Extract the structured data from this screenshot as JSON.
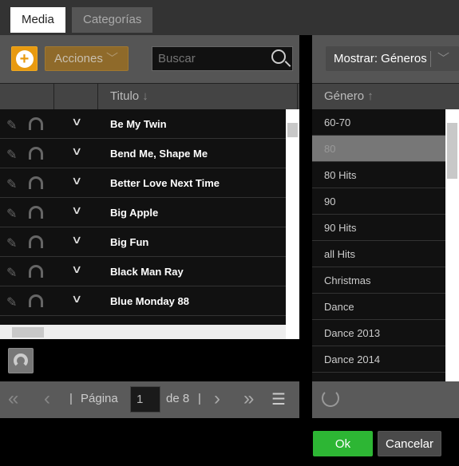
{
  "tabs": [
    {
      "label": "Media",
      "active": true
    },
    {
      "label": "Categorías",
      "active": false
    }
  ],
  "toolbar": {
    "add_icon": "plus-circle-icon",
    "actions_label": "Acciones",
    "search_placeholder": "Buscar"
  },
  "media_table": {
    "sort_column": "Titulo",
    "sort_direction": "descending-arrow",
    "rows": [
      "Be My Twin",
      "Bend Me, Shape Me",
      "Better Love Next Time",
      "Big Apple",
      "Big Fun",
      "Black Man Ray",
      "Blue Monday 88"
    ]
  },
  "pager": {
    "page_label": "Página",
    "page": "1",
    "of_label": "de 8"
  },
  "filter": {
    "label": "Mostrar: Géneros"
  },
  "genre_table": {
    "column": "Género",
    "sort_direction": "ascending-arrow",
    "rows": [
      "60-70",
      "80",
      "80 Hits",
      "90",
      "90 Hits",
      "all Hits",
      "Christmas",
      "Dance",
      "Dance 2013",
      "Dance 2014"
    ],
    "selected": "80"
  },
  "footer": {
    "ok": "Ok",
    "cancel": "Cancelar"
  },
  "colors": {
    "accent": "#e89a10",
    "ok": "#2db634"
  }
}
